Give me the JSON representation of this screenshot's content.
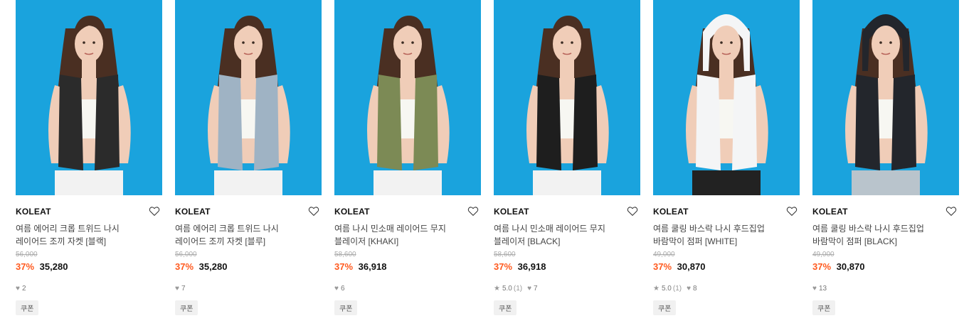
{
  "products": [
    {
      "brand": "KOLEAT",
      "title_line1": "여름 에어리 크롭 트위드 나시",
      "title_line2": "레이어드 조끼 자켓 [블랙]",
      "original_price": "56,000",
      "discount": "37%",
      "price": "35,280",
      "rating": "",
      "review_count": "",
      "likes": "2",
      "badge": "쿠폰",
      "vest_color": "#2b2b2b",
      "bottom_color": "#f2f2f2"
    },
    {
      "brand": "KOLEAT",
      "title_line1": "여름 에어리 크롭 트위드 나시",
      "title_line2": "레이어드 조끼 자켓 [블루]",
      "original_price": "56,000",
      "discount": "37%",
      "price": "35,280",
      "rating": "",
      "review_count": "",
      "likes": "7",
      "badge": "쿠폰",
      "vest_color": "#9fb3c4",
      "bottom_color": "#f2f2f2"
    },
    {
      "brand": "KOLEAT",
      "title_line1": "여름 나시 민소매 레이어드 무지",
      "title_line2": "블레이저 [KHAKI]",
      "original_price": "58,600",
      "discount": "37%",
      "price": "36,918",
      "rating": "",
      "review_count": "",
      "likes": "6",
      "badge": "쿠폰",
      "vest_color": "#7c8a55",
      "bottom_color": "#f2f2f2"
    },
    {
      "brand": "KOLEAT",
      "title_line1": "여름 나시 민소매 레이어드 무지",
      "title_line2": "블레이저 [BLACK]",
      "original_price": "58,600",
      "discount": "37%",
      "price": "36,918",
      "rating": "5.0",
      "review_count": "(1)",
      "likes": "7",
      "badge": "쿠폰",
      "vest_color": "#1e1e1e",
      "bottom_color": "#f2f2f2"
    },
    {
      "brand": "KOLEAT",
      "title_line1": "여름 쿨링 바스락 나시 후드집업",
      "title_line2": "바람막이 점퍼 [WHITE]",
      "original_price": "49,000",
      "discount": "37%",
      "price": "30,870",
      "rating": "5.0",
      "review_count": "(1)",
      "likes": "8",
      "badge": "쿠폰",
      "vest_color": "#f4f5f6",
      "bottom_color": "#222222"
    },
    {
      "brand": "KOLEAT",
      "title_line1": "여름 쿨링 바스락 나시 후드집업",
      "title_line2": "바람막이 점퍼 [BLACK]",
      "original_price": "49,000",
      "discount": "37%",
      "price": "30,870",
      "rating": "",
      "review_count": "",
      "likes": "13",
      "badge": "쿠폰",
      "vest_color": "#23262c",
      "bottom_color": "#b9c4cc"
    }
  ],
  "colors": {
    "background_blue": "#1aa3dd",
    "discount": "#ff5a1f",
    "hair": "#4a2f22",
    "skin": "#f0cdb8"
  }
}
